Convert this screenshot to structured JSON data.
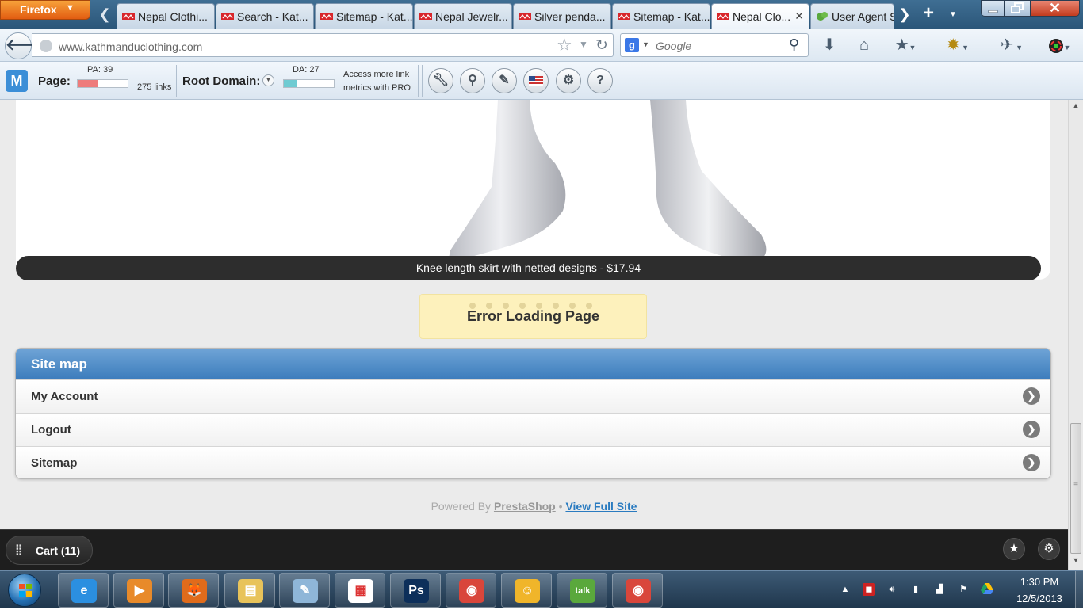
{
  "browser": {
    "menu_button": "Firefox",
    "tabs": [
      {
        "label": "Nepal Clothi..."
      },
      {
        "label": "Search - Kat..."
      },
      {
        "label": "Sitemap - Kat..."
      },
      {
        "label": "Nepal Jewelr..."
      },
      {
        "label": "Silver penda..."
      },
      {
        "label": "Sitemap - Kat..."
      },
      {
        "label": "Nepal Clo...",
        "active": true
      },
      {
        "label": "User Agent S"
      }
    ],
    "url": "www.kathmanduclothing.com",
    "search_engine": "g",
    "search_placeholder": "Google"
  },
  "mozbar": {
    "logo": "M",
    "page_label": "Page:",
    "pa_label": "PA: 39",
    "pa_value": 39,
    "links": "275 links",
    "root_label": "Root Domain:",
    "da_label": "DA: 27",
    "da_value": 27,
    "pro_line1": "Access more link",
    "pro_line2": "metrics with PRO",
    "tools": [
      "wrench-icon",
      "magnifier-icon",
      "pencil-icon",
      "flag-icon",
      "settings-icon",
      "help-icon"
    ]
  },
  "page": {
    "caption": "Knee length skirt with netted designs - $17.94",
    "error": "Error Loading Page",
    "sitemap": {
      "title": "Site map",
      "items": [
        {
          "label": "My Account"
        },
        {
          "label": "Logout"
        },
        {
          "label": "Sitemap"
        }
      ]
    },
    "footer": {
      "powered": "Powered By",
      "prestashop": "PrestaShop",
      "bullet": "•",
      "full_site": "View Full Site"
    }
  },
  "appbar": {
    "cart": "Cart (11)"
  },
  "taskbar": {
    "apps": [
      {
        "name": "internet-explorer",
        "glyph": "e",
        "color": "#2b8fe0"
      },
      {
        "name": "media-player",
        "glyph": "▶",
        "color": "#e88a2a"
      },
      {
        "name": "firefox",
        "glyph": "🦊",
        "color": "#e06b1b"
      },
      {
        "name": "explorer",
        "glyph": "▤",
        "color": "#e8c35a"
      },
      {
        "name": "notepad",
        "glyph": "✎",
        "color": "#8fb6d8"
      },
      {
        "name": "app-grid",
        "glyph": "▦",
        "color": "#ffffff"
      },
      {
        "name": "photoshop",
        "glyph": "Ps",
        "color": "#0d2f5a"
      },
      {
        "name": "chrome",
        "glyph": "◉",
        "color": "#d9463b"
      },
      {
        "name": "messenger",
        "glyph": "☺",
        "color": "#f0b52a"
      },
      {
        "name": "google-talk",
        "glyph": "talk",
        "color": "#5aa83c"
      },
      {
        "name": "chrome-2",
        "glyph": "◉",
        "color": "#d9463b"
      }
    ],
    "time": "1:30 PM",
    "date": "12/5/2013"
  }
}
